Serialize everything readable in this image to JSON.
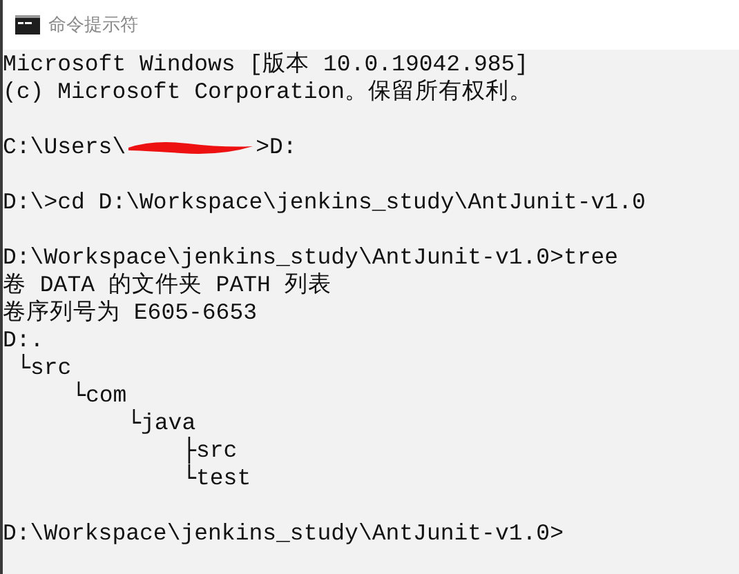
{
  "window": {
    "title": "命令提示符"
  },
  "console": {
    "lines": [
      {
        "kind": "text",
        "text": "Microsoft Windows [版本 10.0.19042.985]"
      },
      {
        "kind": "text",
        "text": "(c) Microsoft Corporation。保留所有权利。"
      },
      {
        "kind": "blank"
      },
      {
        "kind": "redacted",
        "before": "C:\\Users\\",
        "after": ">D:"
      },
      {
        "kind": "blank"
      },
      {
        "kind": "text",
        "text": "D:\\>cd D:\\Workspace\\jenkins_study\\AntJunit-v1.0"
      },
      {
        "kind": "blank"
      },
      {
        "kind": "text",
        "text": "D:\\Workspace\\jenkins_study\\AntJunit-v1.0>tree"
      },
      {
        "kind": "text",
        "text": "卷 DATA 的文件夹 PATH 列表"
      },
      {
        "kind": "text",
        "text": "卷序列号为 E605-6653"
      },
      {
        "kind": "tree",
        "root": "D:.",
        "children": [
          {
            "branch": "└",
            "name": "src",
            "children": [
              {
                "branch": "└",
                "name": "com",
                "children": [
                  {
                    "branch": "└",
                    "name": "java",
                    "children": [
                      {
                        "branch": "├",
                        "name": "src"
                      },
                      {
                        "branch": "└",
                        "name": "test"
                      }
                    ]
                  }
                ]
              }
            ]
          }
        ]
      },
      {
        "kind": "blank"
      },
      {
        "kind": "text",
        "text": "D:\\Workspace\\jenkins_study\\AntJunit-v1.0>"
      }
    ]
  }
}
